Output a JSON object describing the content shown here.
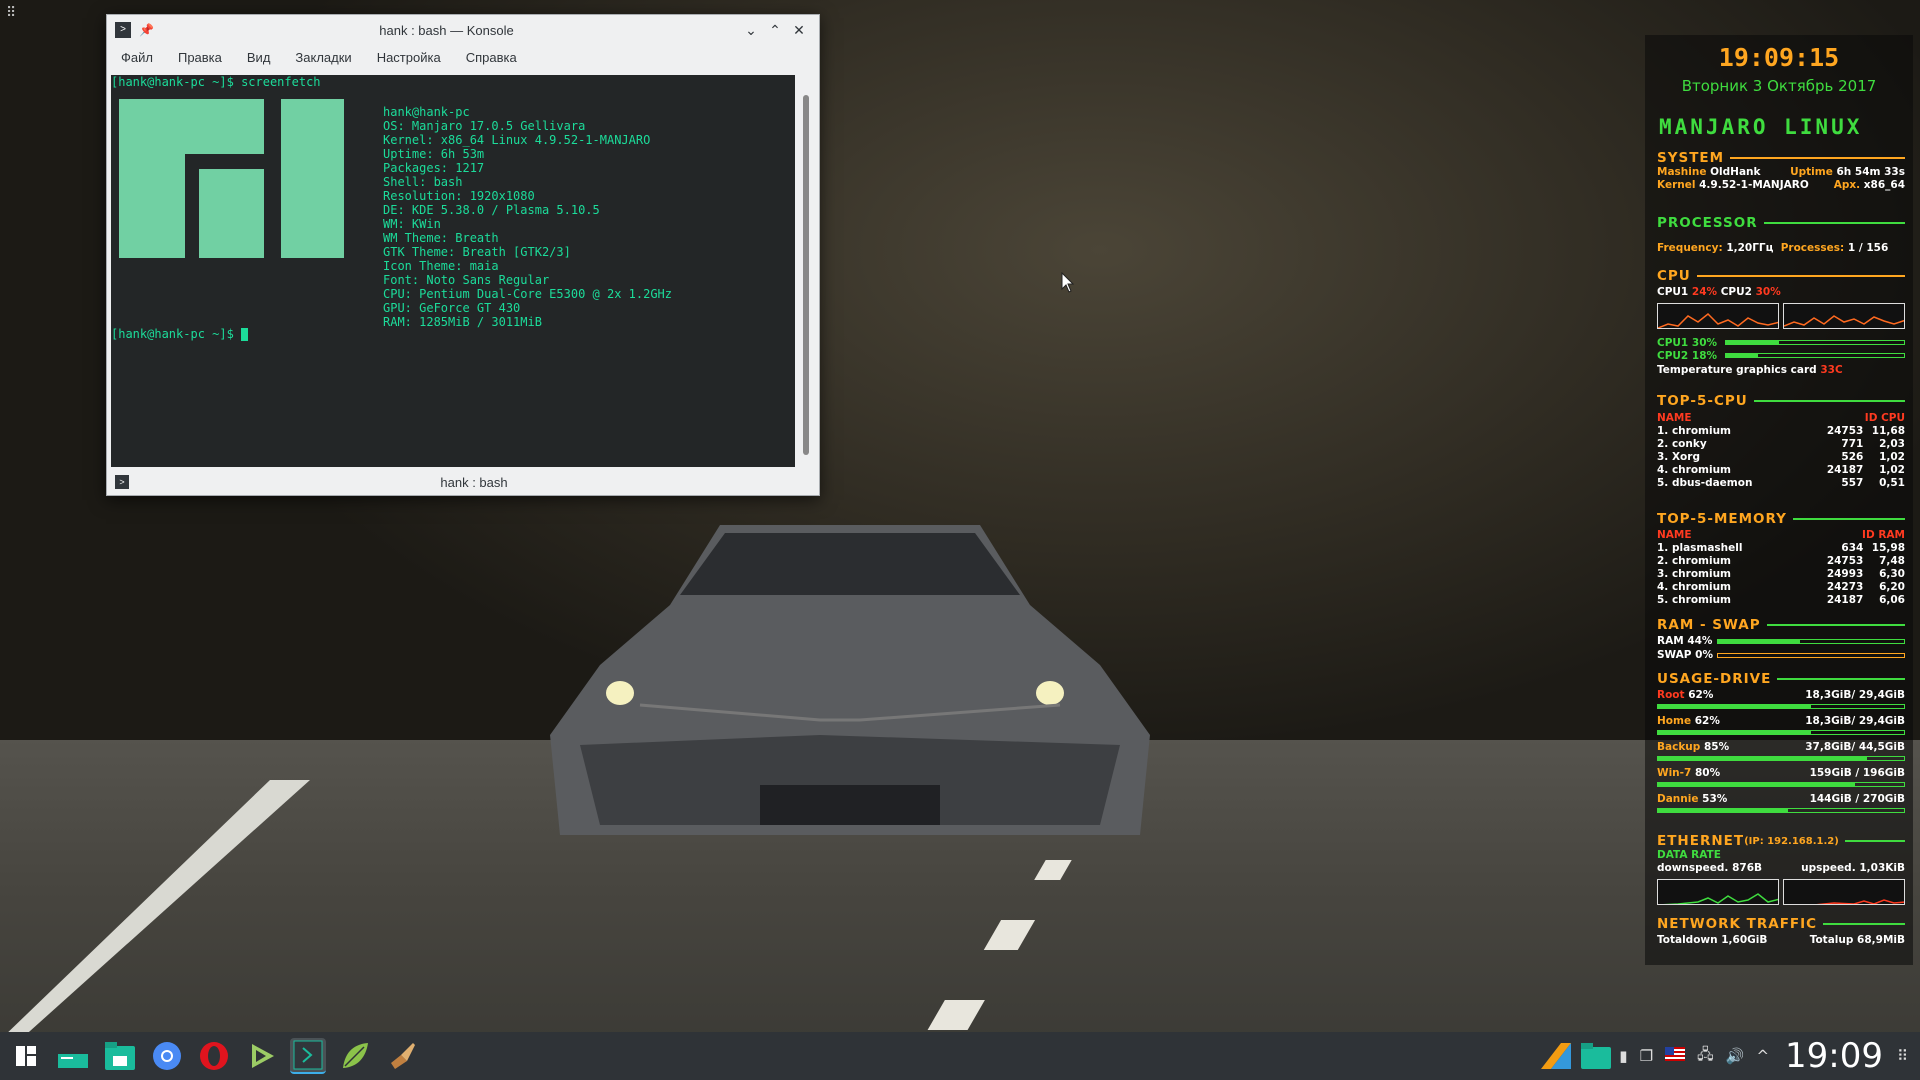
{
  "window": {
    "title": "hank : bash — Konsole",
    "menu": [
      "Файл",
      "Правка",
      "Вид",
      "Закладки",
      "Настройка",
      "Справка"
    ],
    "tab_title": "hank : bash"
  },
  "terminal": {
    "prompt": "[hank@hank-pc ~]$",
    "command": "screenfetch",
    "info": [
      {
        "key": "",
        "value": "hank@hank-pc"
      },
      {
        "key": "OS: ",
        "value": "Manjaro 17.0.5 Gellivara"
      },
      {
        "key": "Kernel: ",
        "value": "x86_64 Linux 4.9.52-1-MANJARO"
      },
      {
        "key": "Uptime: ",
        "value": "6h 53m"
      },
      {
        "key": "Packages: ",
        "value": "1217"
      },
      {
        "key": "Shell: ",
        "value": "bash"
      },
      {
        "key": "Resolution: ",
        "value": "1920x1080"
      },
      {
        "key": "DE: ",
        "value": "KDE 5.38.0 / Plasma 5.10.5"
      },
      {
        "key": "WM: ",
        "value": "KWin"
      },
      {
        "key": "WM Theme: ",
        "value": "Breath"
      },
      {
        "key": "GTK Theme: ",
        "value": "Breath [GTK2/3]"
      },
      {
        "key": "Icon Theme: ",
        "value": "maia"
      },
      {
        "key": "Font: ",
        "value": "Noto Sans Regular"
      },
      {
        "key": "CPU: ",
        "value": "Pentium Dual-Core E5300 @ 2x 1.2GHz"
      },
      {
        "key": "GPU: ",
        "value": "GeForce GT 430"
      },
      {
        "key": "RAM: ",
        "value": "1285MiB / 3011MiB"
      }
    ]
  },
  "conky": {
    "time": "19:09:15",
    "date": "Вторник  3 Октябрь 2017",
    "distro": "MANJARO LINUX",
    "system": {
      "title": "SYSTEM",
      "machine_label": "Mashine",
      "machine": "OldHank",
      "uptime_label": "Uptime",
      "uptime": "6h 54m 33s",
      "kernel_label": "Kernel",
      "kernel": "4.9.52-1-MANJARO",
      "arch_label": "Apx.",
      "arch": "x86_64"
    },
    "processor": {
      "title": "PROCESSOR",
      "freq_label": "Frequency:",
      "freq": "1,20ГГц",
      "proc_label": "Processes:",
      "proc": "1  / 156"
    },
    "cpu": {
      "title": "CPU",
      "cpu1_label": "CPU1",
      "cpu1_pct": "24%",
      "cpu2_label": "CPU2",
      "cpu2_pct": "30%",
      "bar1_label": "CPU1",
      "bar1_pct": "30%",
      "bar1_value": 0.3,
      "bar2_label": "CPU2",
      "bar2_pct": "18%",
      "bar2_value": 0.18,
      "temp_label": "Temperature graphics card",
      "temp": "33C"
    },
    "top_cpu": {
      "title": "TOP-5-CPU",
      "h_name": "NAME",
      "h_id": "ID",
      "h_val": "CPU",
      "rows": [
        {
          "name": "1. chromium",
          "id": "24753",
          "val": "11,68"
        },
        {
          "name": "2. conky",
          "id": "771",
          "val": "2,03"
        },
        {
          "name": "3. Xorg",
          "id": "526",
          "val": "1,02"
        },
        {
          "name": "4. chromium",
          "id": "24187",
          "val": "1,02"
        },
        {
          "name": "5. dbus-daemon",
          "id": "557",
          "val": "0,51"
        }
      ]
    },
    "top_mem": {
      "title": "TOP-5-MEMORY",
      "h_name": "NAME",
      "h_id": "ID",
      "h_val": "RAM",
      "rows": [
        {
          "name": "1. plasmashell",
          "id": "634",
          "val": "15,98"
        },
        {
          "name": "2. chromium",
          "id": "24753",
          "val": "7,48"
        },
        {
          "name": "3. chromium",
          "id": "24993",
          "val": "6,30"
        },
        {
          "name": "4. chromium",
          "id": "24273",
          "val": "6,20"
        },
        {
          "name": "5. chromium",
          "id": "24187",
          "val": "6,06"
        }
      ]
    },
    "ramswap": {
      "title": "RAM - SWAP",
      "ram_label": "RAM 44%",
      "ram_value": 0.44,
      "swap_label": "SWAP 0%",
      "swap_value": 0.0
    },
    "drive": {
      "title": "USAGE-DRIVE",
      "rows": [
        {
          "name": "Root",
          "pct": "62%",
          "usage": "18,3GiB/ 29,4GiB",
          "value": 0.62
        },
        {
          "name": "Home",
          "pct": "62%",
          "usage": "18,3GiB/ 29,4GiB",
          "value": 0.62
        },
        {
          "name": "Backup",
          "pct": "85%",
          "usage": "37,8GiB/ 44,5GiB",
          "value": 0.85
        },
        {
          "name": "Win-7",
          "pct": "80%",
          "usage": "159GiB / 196GiB",
          "value": 0.8
        },
        {
          "name": "Dannie",
          "pct": "53%",
          "usage": "144GiB / 270GiB",
          "value": 0.53
        }
      ]
    },
    "ethernet": {
      "title": "ETHERNET",
      "ip": "(IP: 192.168.1.2)",
      "data_rate": "DATA RATE",
      "down_label": "downspeed.",
      "down": "876B",
      "up_label": "upspeed.",
      "up": "1,03KiB"
    },
    "traffic": {
      "title": "NETWORK TRAFFIC",
      "down_label": "Totaldown",
      "down": "1,60GiB",
      "up_label": "Totalup",
      "up": "68,9MiB"
    }
  },
  "taskbar": {
    "clock": "19:09",
    "launchers": [
      "application-launcher-icon",
      "desktop-icon",
      "file-manager-icon",
      "chromium-icon",
      "opera-icon",
      "play-icon",
      "konsole-icon",
      "leaf-icon",
      "brush-icon"
    ]
  }
}
